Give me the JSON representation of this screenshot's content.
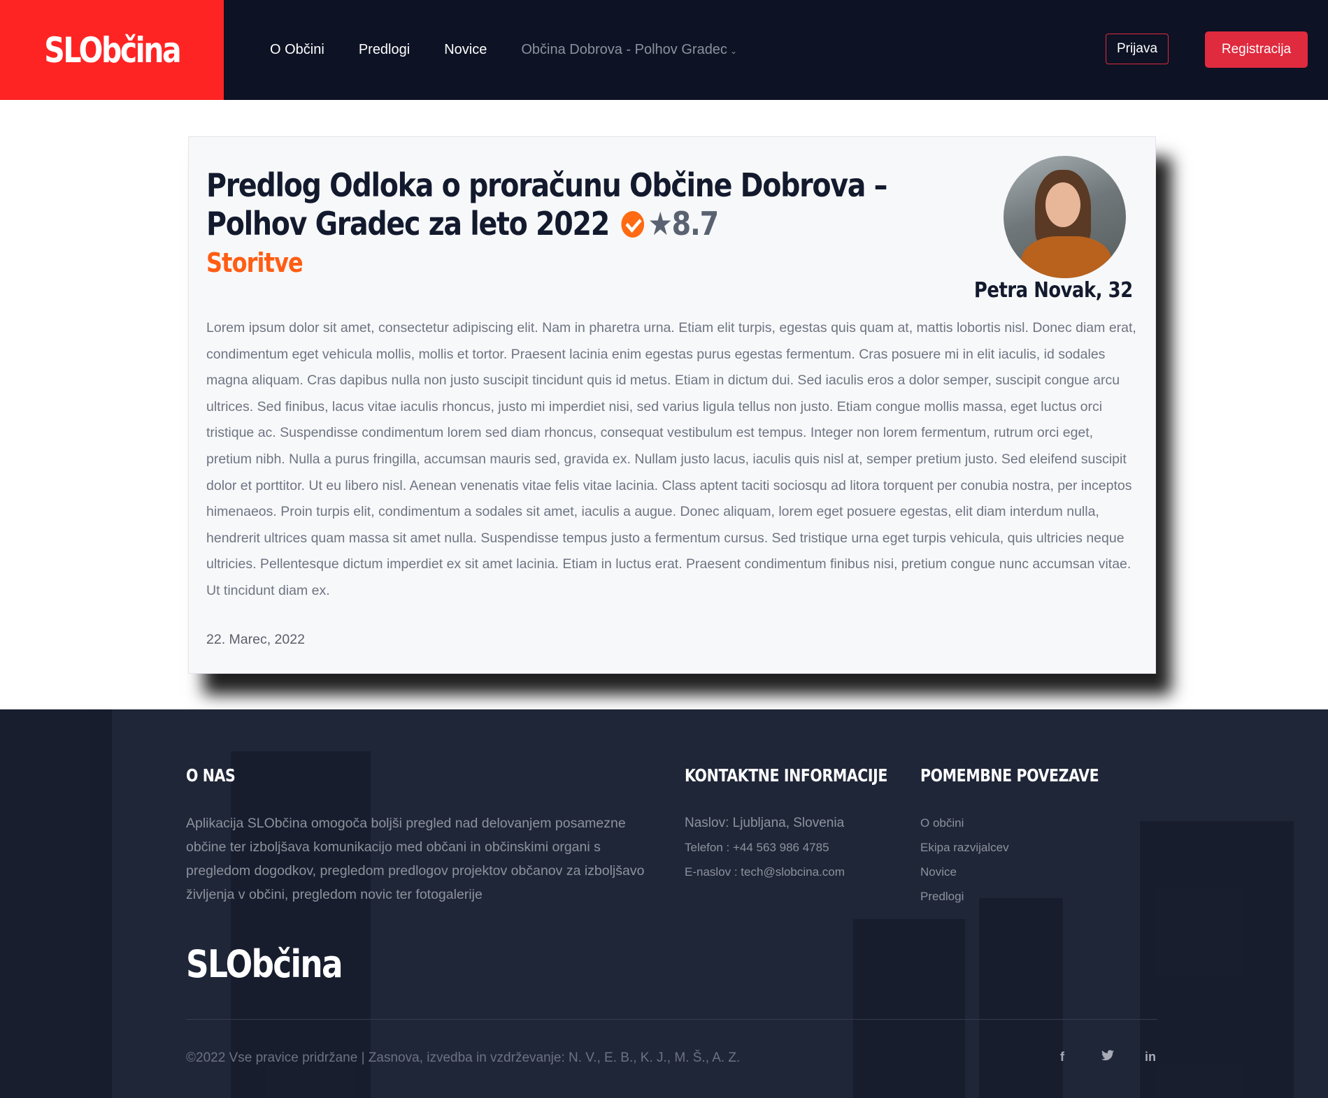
{
  "nav": {
    "logo": "SLObčina",
    "links": [
      "O Občini",
      "Predlogi",
      "Novice"
    ],
    "municipality": "Občina Dobrova - Polhov Gradec",
    "login": "Prijava",
    "register": "Registracija"
  },
  "proposal": {
    "title": "Predlog Odloka o proračunu Občine Dobrova – Polhov Gradec za leto 2022",
    "rating": "8.7",
    "category": "Storitve",
    "author": "Petra Novak, 32",
    "body": "Lorem ipsum dolor sit amet, consectetur adipiscing elit. Nam in pharetra urna. Etiam elit turpis, egestas quis quam at, mattis lobortis nisl. Donec diam erat, condimentum eget vehicula mollis, mollis et tortor. Praesent lacinia enim egestas purus egestas fermentum. Cras posuere mi in elit iaculis, id sodales magna aliquam. Cras dapibus nulla non justo suscipit tincidunt quis id metus. Etiam in dictum dui. Sed iaculis eros a dolor semper, suscipit congue arcu ultrices. Sed finibus, lacus vitae iaculis rhoncus, justo mi imperdiet nisi, sed varius ligula tellus non justo. Etiam congue mollis massa, eget luctus orci tristique ac. Suspendisse condimentum lorem sed diam rhoncus, consequat vestibulum est tempus. Integer non lorem fermentum, rutrum orci eget, pretium nibh. Nulla a purus fringilla, accumsan mauris sed, gravida ex. Nullam justo lacus, iaculis quis nisl at, semper pretium justo. Sed eleifend suscipit dolor et porttitor. Ut eu libero nisl. Aenean venenatis vitae felis vitae lacinia. Class aptent taciti sociosqu ad litora torquent per conubia nostra, per inceptos himenaeos. Proin turpis elit, condimentum a sodales sit amet, iaculis a augue. Donec aliquam, lorem eget posuere egestas, elit diam interdum nulla, hendrerit ultrices quam massa sit amet nulla. Suspendisse tempus justo a fermentum cursus. Sed tristique urna eget turpis vehicula, quis ultricies neque ultricies. Pellentesque dictum imperdiet ex sit amet lacinia. Etiam in luctus erat. Praesent condimentum finibus nisi, pretium congue nunc accumsan vitae. Ut tincidunt diam ex.",
    "date": "22. Marec, 2022",
    "verified_icon": "check-circle-icon",
    "star_icon": "star-icon"
  },
  "footer": {
    "about_heading": "O NAS",
    "about_text": "Aplikacija SLObčina omogoča boljši pregled nad delovanjem posamezne občine ter izboljšava komunikacijo med občani in občinskimi organi s pregledom dogodkov, pregledom predlogov projektov občanov za izboljšavo življenja v občini, pregledom novic ter fotogalerije",
    "contact_heading": "KONTAKTNE INFORMACIJE",
    "address": "Naslov: Ljubljana, Slovenia",
    "phone": "Telefon : +44 563 986 4785",
    "email": "E-naslov : tech@slobcina.com",
    "links_heading": "POMEMBNE POVEZAVE",
    "links": [
      "O občini",
      "Ekipa razvijalcev",
      "Novice",
      "Predlogi"
    ],
    "logo": "SLObčina",
    "copyright": "©2022 Vse pravice pridržane | Zasnova, izvedba in vzdrževanje: N. V., E. B., K. J., M. Š., A. Z.",
    "social": [
      "facebook-icon",
      "twitter-icon",
      "linkedin-icon"
    ]
  },
  "colors": {
    "brand_red": "#ff2424",
    "accent_orange": "#ff5d13",
    "button_red": "#e02a3e",
    "nav_bg": "#0d1224",
    "footer_bg": "#1f2638"
  }
}
